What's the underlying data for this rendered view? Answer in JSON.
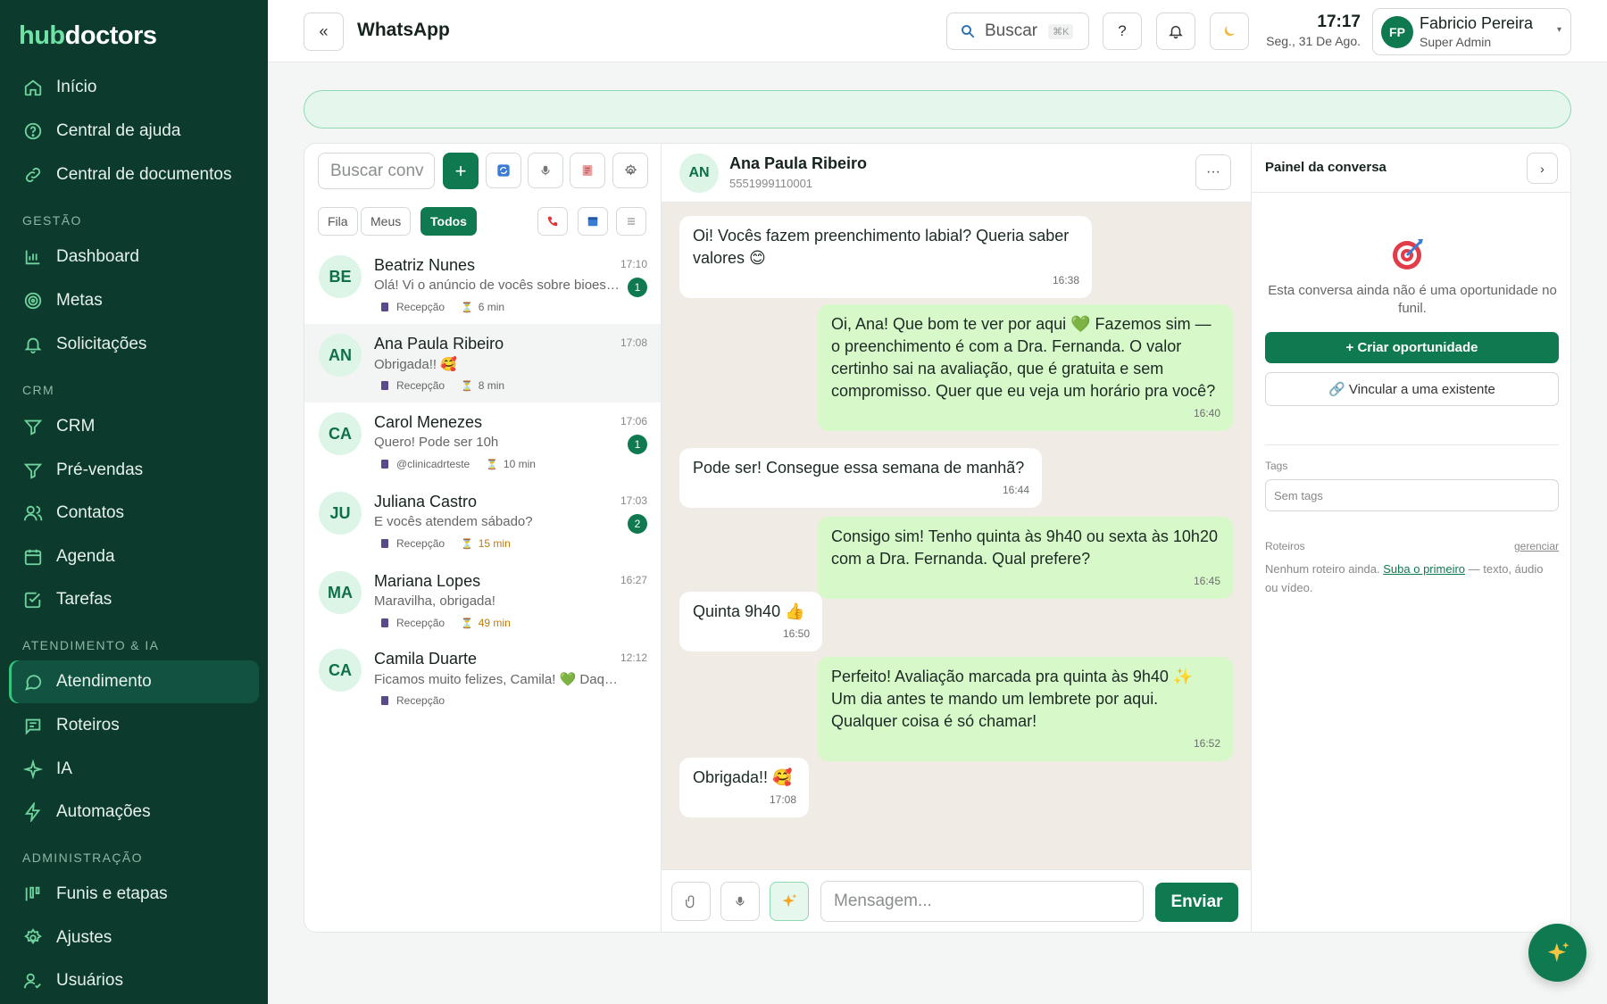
{
  "brand": {
    "part1": "hub",
    "part2": "doctors"
  },
  "sidebar": {
    "items": [
      {
        "label": "Início",
        "icon": "home-icon"
      },
      {
        "label": "Central de ajuda",
        "icon": "help-circle-icon"
      },
      {
        "label": "Central de documentos",
        "icon": "link-icon"
      }
    ],
    "sections": [
      {
        "title": "GESTÃO",
        "items": [
          {
            "label": "Dashboard",
            "icon": "bar-chart-icon"
          },
          {
            "label": "Metas",
            "icon": "target-icon"
          },
          {
            "label": "Solicitações",
            "icon": "bell-icon"
          }
        ]
      },
      {
        "title": "CRM",
        "items": [
          {
            "label": "CRM",
            "icon": "funnel-icon"
          },
          {
            "label": "Pré-vendas",
            "icon": "funnel-icon"
          },
          {
            "label": "Contatos",
            "icon": "users-icon"
          },
          {
            "label": "Agenda",
            "icon": "calendar-icon"
          },
          {
            "label": "Tarefas",
            "icon": "checkbox-icon"
          }
        ]
      },
      {
        "title": "ATENDIMENTO & IA",
        "items": [
          {
            "label": "Atendimento",
            "icon": "chat-icon",
            "active": true
          },
          {
            "label": "Roteiros",
            "icon": "script-icon"
          },
          {
            "label": "IA",
            "icon": "sparkle-icon"
          },
          {
            "label": "Automações",
            "icon": "bolt-icon"
          }
        ]
      },
      {
        "title": "ADMINISTRAÇÃO",
        "items": [
          {
            "label": "Funis e etapas",
            "icon": "kanban-icon"
          },
          {
            "label": "Ajustes",
            "icon": "gear-icon"
          },
          {
            "label": "Usuários",
            "icon": "user-check-icon"
          }
        ]
      }
    ]
  },
  "topbar": {
    "collapse": "«",
    "title": "WhatsApp",
    "search_label": "Buscar",
    "search_kbd": "⌘K",
    "help": "?",
    "time": "17:17",
    "date": "Seg., 31 De Ago.",
    "user": {
      "initials": "FP",
      "name": "Fabricio Pereira",
      "role": "Super Admin"
    }
  },
  "conversations": {
    "search_placeholder": "Buscar conv",
    "add": "+",
    "filters": [
      "Fila",
      "Meus",
      "Todos"
    ],
    "active_filter": "Todos",
    "items": [
      {
        "initials": "BE",
        "name": "Beatriz Nunes",
        "time": "17:10",
        "preview": "Olá! Vi o anúncio de vocês sobre bioestimulador",
        "unread": "1",
        "channel": "Recepção",
        "wait": "6 min",
        "wait_warn": false
      },
      {
        "initials": "AN",
        "name": "Ana Paula Ribeiro",
        "time": "17:08",
        "preview": "Obrigada!! 🥰",
        "unread": "",
        "channel": "Recepção",
        "wait": "8 min",
        "wait_warn": false
      },
      {
        "initials": "CA",
        "name": "Carol Menezes",
        "time": "17:06",
        "preview": "Quero! Pode ser 10h",
        "unread": "1",
        "channel": "@clinicadrteste",
        "wait": "10 min",
        "wait_warn": false
      },
      {
        "initials": "JU",
        "name": "Juliana Castro",
        "time": "17:03",
        "preview": "E vocês atendem sábado?",
        "unread": "2",
        "channel": "Recepção",
        "wait": "15 min",
        "wait_warn": true
      },
      {
        "initials": "MA",
        "name": "Mariana Lopes",
        "time": "16:27",
        "preview": "Maravilha, obrigada!",
        "unread": "",
        "channel": "Recepção",
        "wait": "49 min",
        "wait_warn": true
      },
      {
        "initials": "CA",
        "name": "Camila Duarte",
        "time": "12:12",
        "preview": "Ficamos muito felizes, Camila! 💚 Daqui a pouco",
        "unread": "",
        "channel": "Recepção",
        "wait": "",
        "wait_warn": false
      }
    ]
  },
  "chat": {
    "contact": {
      "initials": "AN",
      "name": "Ana Paula Ribeiro",
      "phone": "5551999110001"
    },
    "more": "···",
    "messages": [
      {
        "dir": "in",
        "text": "Oi! Vocês fazem preenchimento labial? Queria saber valores 😊",
        "time": "16:38"
      },
      {
        "dir": "out",
        "text": "Oi, Ana! Que bom te ver por aqui 💚 Fazemos sim — o preenchimento é com a Dra. Fernanda. O valor certinho sai na avaliação, que é gratuita e sem compromisso. Quer que eu veja um horário pra você?",
        "time": "16:40"
      },
      {
        "dir": "in",
        "text": "Pode ser! Consegue essa semana de manhã?",
        "time": "16:44"
      },
      {
        "dir": "out",
        "text": "Consigo sim! Tenho quinta às 9h40 ou sexta às 10h20 com a Dra. Fernanda. Qual prefere?",
        "time": "16:45"
      },
      {
        "dir": "in",
        "text": "Quinta 9h40 👍",
        "time": "16:50"
      },
      {
        "dir": "out",
        "text": "Perfeito! Avaliação marcada pra quinta às 9h40 ✨ Um dia antes te mando um lembrete por aqui. Qualquer coisa é só chamar!",
        "time": "16:52"
      },
      {
        "dir": "in",
        "text": "Obrigada!! 🥰",
        "time": "17:08"
      }
    ],
    "input_placeholder": "Mensagem...",
    "send": "Enviar"
  },
  "panel": {
    "title": "Painel da conversa",
    "empty": "Esta conversa ainda não é uma oportunidade no funil.",
    "create": "+ Criar oportunidade",
    "link": "🔗 Vincular a uma existente",
    "tags_label": "Tags",
    "tags_placeholder": "Sem tags",
    "scripts_label": "Roteiros",
    "scripts_manage": "gerenciar",
    "scripts_text_a": "Nenhum roteiro ainda. ",
    "scripts_link": "Suba o primeiro",
    "scripts_text_b": " — texto, áudio ou vídeo."
  },
  "colors": {
    "brand": "#0f7a4f",
    "sidebar": "#0c3b2e",
    "outgoing": "#d7f9c9",
    "chat_bg": "#f0ebe4"
  }
}
